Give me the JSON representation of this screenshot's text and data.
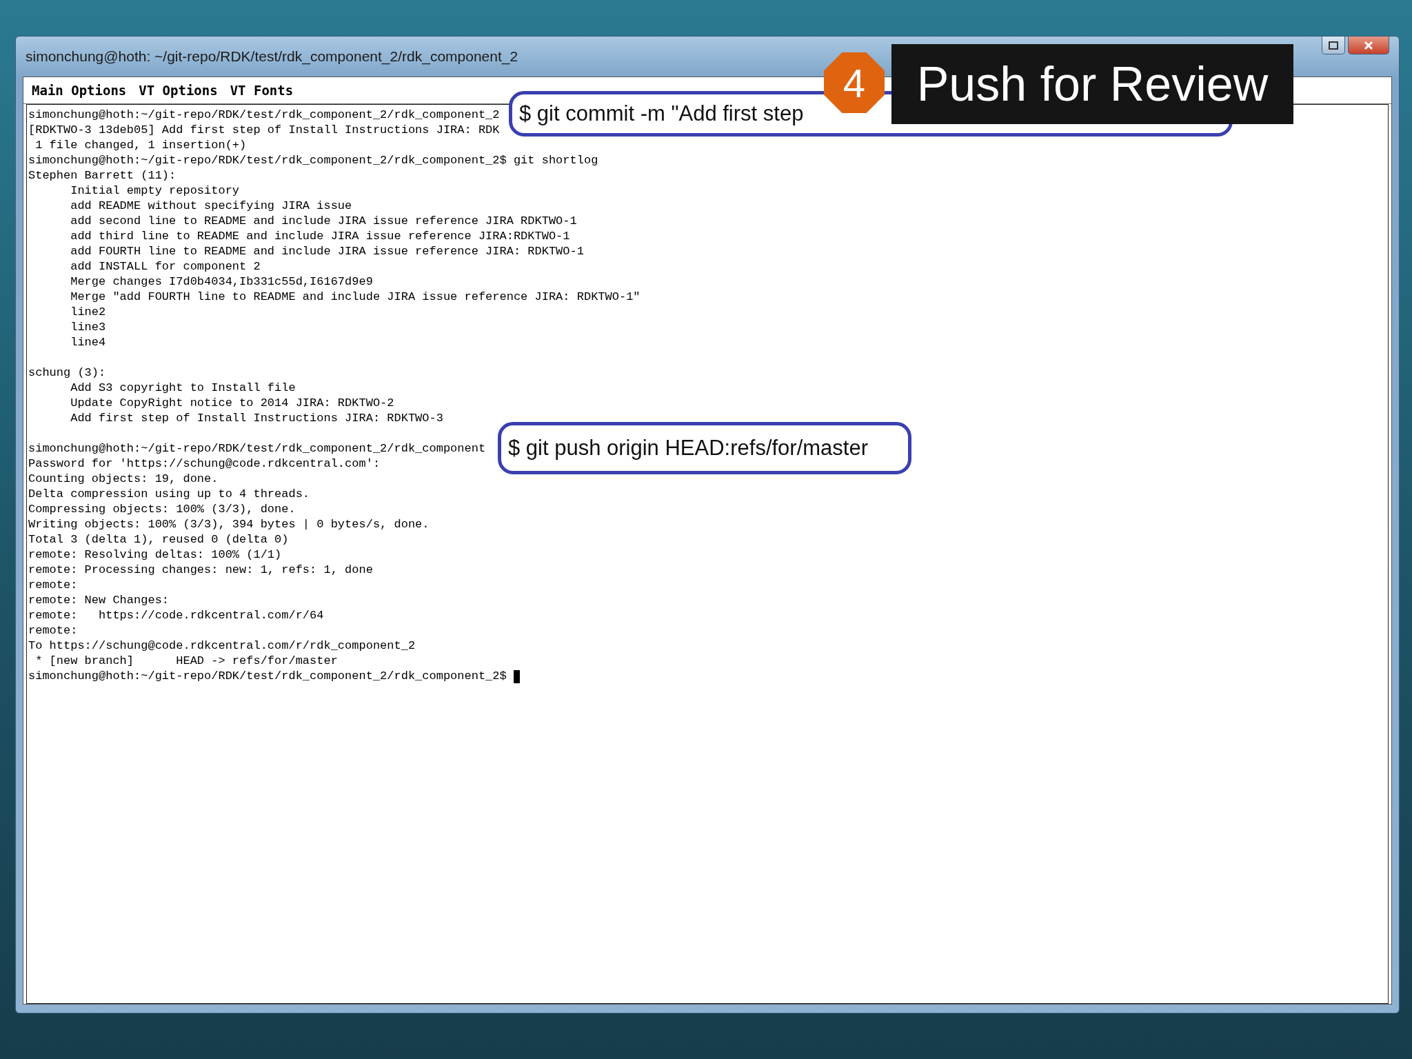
{
  "window": {
    "title": "simonchung@hoth: ~/git-repo/RDK/test/rdk_component_2/rdk_component_2"
  },
  "menu": [
    "Main Options",
    "VT Options",
    "VT Fonts"
  ],
  "terminal": {
    "blocks": [
      [
        "simonchung@hoth:~/git-repo/RDK/test/rdk_component_2/rdk_component_2",
        "[RDKTWO-3 13deb05] Add first step of Install Instructions JIRA: RDK",
        " 1 file changed, 1 insertion(+)",
        "simonchung@hoth:~/git-repo/RDK/test/rdk_component_2/rdk_component_2$ git shortlog",
        "Stephen Barrett (11):",
        "      Initial empty repository",
        "      add README without specifying JIRA issue",
        "      add second line to README and include JIRA issue reference JIRA RDKTWO-1",
        "      add third line to README and include JIRA issue reference JIRA:RDKTWO-1",
        "      add FOURTH line to README and include JIRA issue reference JIRA: RDKTWO-1",
        "      add INSTALL for component 2",
        "      Merge changes I7d0b4034,Ib331c55d,I6167d9e9",
        "      Merge \"add FOURTH line to README and include JIRA issue reference JIRA: RDKTWO-1\"",
        "      line2",
        "      line3",
        "      line4"
      ],
      [
        "schung (3):",
        "      Add S3 copyright to Install file",
        "      Update CopyRight notice to 2014 JIRA: RDKTWO-2",
        "      Add first step of Install Instructions JIRA: RDKTWO-3"
      ],
      [
        "simonchung@hoth:~/git-repo/RDK/test/rdk_component_2/rdk_component",
        "Password for 'https://schung@code.rdkcentral.com':",
        "Counting objects: 19, done.",
        "Delta compression using up to 4 threads.",
        "Compressing objects: 100% (3/3), done.",
        "Writing objects: 100% (3/3), 394 bytes | 0 bytes/s, done.",
        "Total 3 (delta 1), reused 0 (delta 0)",
        "remote: Resolving deltas: 100% (1/1)",
        "remote: Processing changes: new: 1, refs: 1, done",
        "remote:",
        "remote: New Changes:",
        "remote:   https://code.rdkcentral.com/r/64",
        "remote:",
        "To https://schung@code.rdkcentral.com/r/rdk_component_2",
        " * [new branch]      HEAD -> refs/for/master",
        "simonchung@hoth:~/git-repo/RDK/test/rdk_component_2/rdk_component_2$ "
      ]
    ]
  },
  "annotations": [
    {
      "kind": "commit",
      "text": "$ git commit -m \"Add first step"
    },
    {
      "kind": "push",
      "text": "$ git push origin HEAD:refs/for/master"
    }
  ],
  "step": {
    "number": "4",
    "title": "Push for Review"
  }
}
